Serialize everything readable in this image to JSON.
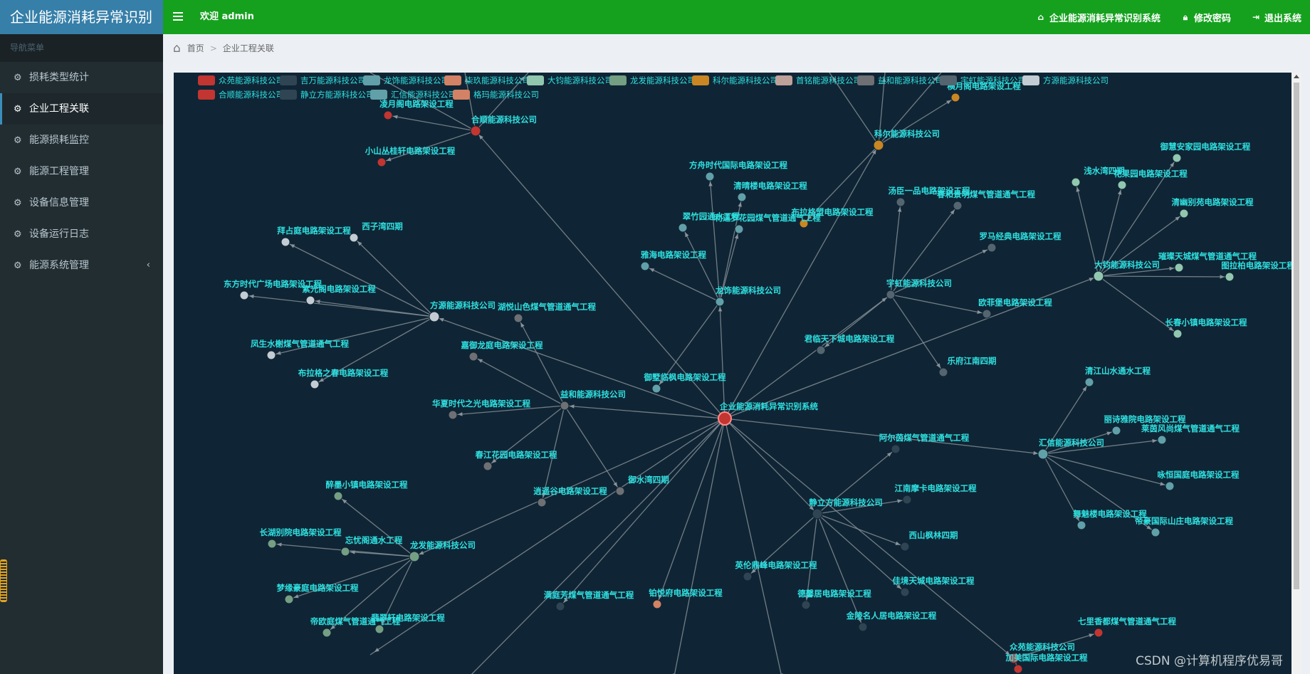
{
  "app": {
    "title": "企业能源消耗异常识别",
    "welcome": "欢迎 admin",
    "topnav": [
      {
        "label": "企业能源消耗异常识别系统",
        "icon": "home-icon"
      },
      {
        "label": "修改密码",
        "icon": "lock-icon"
      },
      {
        "label": "退出系统",
        "icon": "sign-out-icon"
      }
    ]
  },
  "sidebar": {
    "heading": "导航菜单",
    "items": [
      {
        "label": "损耗类型统计",
        "icon": "gear-icon"
      },
      {
        "label": "企业工程关联",
        "icon": "gear-icon",
        "active": true
      },
      {
        "label": "能源损耗监控",
        "icon": "gear-icon"
      },
      {
        "label": "能源工程管理",
        "icon": "gear-icon"
      },
      {
        "label": "设备信息管理",
        "icon": "gear-icon"
      },
      {
        "label": "设备运行日志",
        "icon": "gear-icon"
      },
      {
        "label": "能源系统管理",
        "icon": "gear-icon",
        "has_submenu": true
      }
    ]
  },
  "breadcrumb": [
    "首页",
    "企业工程关联"
  ],
  "graph": {
    "center": "企业能源消耗异常识别系统",
    "legend": [
      {
        "name": "众苑能源科技公司",
        "color": "#c23531"
      },
      {
        "name": "吉万能源科技公司",
        "color": "#2f4554"
      },
      {
        "name": "龙饰能源科技公司",
        "color": "#61a0a8"
      },
      {
        "name": "柒玖能源科技公司",
        "color": "#d48265"
      },
      {
        "name": "大钧能源科技公司",
        "color": "#91c7ae"
      },
      {
        "name": "龙发能源科技公司",
        "color": "#749f83"
      },
      {
        "name": "科尔能源科技公司",
        "color": "#ca8622"
      },
      {
        "name": "首铭能源科技公司",
        "color": "#bda29a"
      },
      {
        "name": "益和能源科技公司",
        "color": "#6e7074"
      },
      {
        "name": "宇虹能源科技公司",
        "color": "#546570"
      },
      {
        "name": "方源能源科技公司",
        "color": "#c4ccd3"
      },
      {
        "name": "合顺能源科技公司",
        "color": "#c23531"
      },
      {
        "name": "静立方能源科技公司",
        "color": "#2f4554"
      },
      {
        "name": "汇信能源科技公司",
        "color": "#61a0a8"
      },
      {
        "name": "格玛能源科技公司",
        "color": "#d48265"
      }
    ],
    "nodes": [
      {
        "label": "合顺能源科技公司",
        "color": "#c23531"
      },
      {
        "label": "凌月阁电路架设工程",
        "color": "#c23531"
      },
      {
        "label": "小山丛桂轩电路架设工程",
        "color": "#c23531"
      },
      {
        "label": "科尔能源科技公司",
        "color": "#ca8622"
      },
      {
        "label": "横月阁电路架设工程",
        "color": "#ca8622"
      },
      {
        "label": "布拉格盟电路架设工程",
        "color": "#ca8622"
      },
      {
        "label": "龙饰能源科技公司",
        "color": "#61a0a8"
      },
      {
        "label": "方舟时代国际电路架设工程",
        "color": "#61a0a8"
      },
      {
        "label": "清晴楼电路架设工程",
        "color": "#61a0a8"
      },
      {
        "label": "翠竹园通水工程",
        "color": "#61a0a8"
      },
      {
        "label": "利道罗花园煤气管道通气工程",
        "color": "#61a0a8"
      },
      {
        "label": "雅海电路架设工程",
        "color": "#61a0a8"
      },
      {
        "label": "御墅临枫电路架设工程",
        "color": "#61a0a8"
      },
      {
        "label": "方源能源科技公司",
        "color": "#c4ccd3"
      },
      {
        "label": "拜占庭电路架设工程",
        "color": "#c4ccd3"
      },
      {
        "label": "西子湾四期",
        "color": "#c4ccd3"
      },
      {
        "label": "东方时代广场电路架设工程",
        "color": "#c4ccd3"
      },
      {
        "label": "紫光阁电路架设工程",
        "color": "#c4ccd3"
      },
      {
        "label": "凤生水榭煤气管道通气工程",
        "color": "#c4ccd3"
      },
      {
        "label": "布拉格之春电路架设工程",
        "color": "#c4ccd3"
      },
      {
        "label": "益和能源科技公司",
        "color": "#6e7074"
      },
      {
        "label": "湖悦山色煤气管道通气工程",
        "color": "#6e7074"
      },
      {
        "label": "嘉御龙庭电路架设工程",
        "color": "#6e7074"
      },
      {
        "label": "华夏时代之光电路架设工程",
        "color": "#6e7074"
      },
      {
        "label": "春江花园电路架设工程",
        "color": "#6e7074"
      },
      {
        "label": "逍遥谷电路架设工程",
        "color": "#6e7074"
      },
      {
        "label": "御水湾四期",
        "color": "#6e7074"
      },
      {
        "label": "宇虹能源科技公司",
        "color": "#546570"
      },
      {
        "label": "汤臣一品电路架设工程",
        "color": "#546570"
      },
      {
        "label": "春和景明煤气管道通气工程",
        "color": "#546570"
      },
      {
        "label": "罗马经典电路架设工程",
        "color": "#546570"
      },
      {
        "label": "欧菲堡电路架设工程",
        "color": "#546570"
      },
      {
        "label": "君临天下城电路架设工程",
        "color": "#546570"
      },
      {
        "label": "乐府江南四期",
        "color": "#546570"
      },
      {
        "label": "大钧能源科技公司",
        "color": "#91c7ae"
      },
      {
        "label": "浅水湾四期",
        "color": "#91c7ae"
      },
      {
        "label": "花果园电路架设工程",
        "color": "#91c7ae"
      },
      {
        "label": "御慧安家园电路架设工程",
        "color": "#91c7ae"
      },
      {
        "label": "清幽别苑电路架设工程",
        "color": "#91c7ae"
      },
      {
        "label": "璀璨天城煤气管道通气工程",
        "color": "#91c7ae"
      },
      {
        "label": "图拉柏电路架设工程",
        "color": "#91c7ae"
      },
      {
        "label": "长春小镇电路架设工程",
        "color": "#91c7ae"
      },
      {
        "label": "汇信能源科技公司",
        "color": "#61a0a8"
      },
      {
        "label": "清江山水通水工程",
        "color": "#61a0a8"
      },
      {
        "label": "丽诗雅院电路架设工程",
        "color": "#61a0a8"
      },
      {
        "label": "莱茵风尚煤气管道通气工程",
        "color": "#61a0a8"
      },
      {
        "label": "咏恒国庭电路架设工程",
        "color": "#61a0a8"
      },
      {
        "label": "舞魅楼电路架设工程",
        "color": "#61a0a8"
      },
      {
        "label": "帝豪国际山庄电路架设工程",
        "color": "#61a0a8"
      },
      {
        "label": "静立方能源科技公司",
        "color": "#2f4554"
      },
      {
        "label": "阿尔茵煤气管道通气工程",
        "color": "#2f4554"
      },
      {
        "label": "江南摩卡电路架设工程",
        "color": "#2f4554"
      },
      {
        "label": "西山枫林四期",
        "color": "#2f4554"
      },
      {
        "label": "佳境天城电路架设工程",
        "color": "#2f4554"
      },
      {
        "label": "金陵名人居电路架设工程",
        "color": "#2f4554"
      },
      {
        "label": "德馨居电路架设工程",
        "color": "#2f4554"
      },
      {
        "label": "英伦鼎峰电路架设工程",
        "color": "#2f4554"
      },
      {
        "label": "龙发能源科技公司",
        "color": "#749f83"
      },
      {
        "label": "醉墨小镇电路架设工程",
        "color": "#749f83"
      },
      {
        "label": "长湖别院电路架设工程",
        "color": "#749f83"
      },
      {
        "label": "忘忧阁通水工程",
        "color": "#749f83"
      },
      {
        "label": "梦缘豪庭电路架设工程",
        "color": "#749f83"
      },
      {
        "label": "帝欧庭煤气管道通气工程",
        "color": "#749f83"
      },
      {
        "label": "翡翠轩电路架设工程",
        "color": "#749f83"
      },
      {
        "label": "满庭芳煤气管道通气工程",
        "color": "#2f4554"
      },
      {
        "label": "铂悦府电路架设工程",
        "color": "#d48265"
      },
      {
        "label": "众苑能源科技公司",
        "color": "#c23531"
      },
      {
        "label": "七里香都煤气管道通气工程",
        "color": "#c23531"
      },
      {
        "label": "加美国际电路架设工程",
        "color": "#c23531"
      }
    ]
  },
  "watermark": "CSDN @计算机程序优易哥"
}
